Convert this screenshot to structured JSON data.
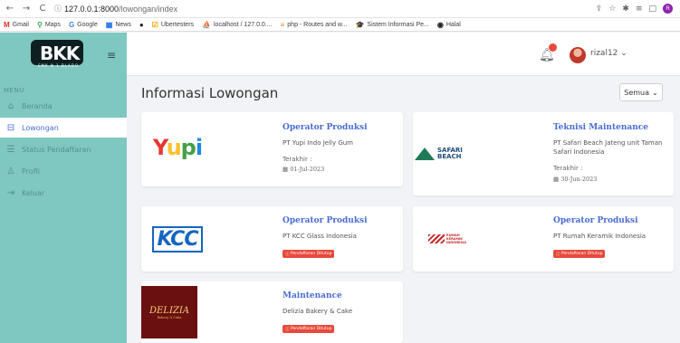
{
  "browser": {
    "url_host": "127.0.0.1:8000",
    "url_path": "/lowongan/index",
    "profile_initial": "R",
    "bookmarks": [
      "Gmail",
      "Maps",
      "Google",
      "News",
      "",
      "Ubertesters",
      "localhost / 127.0.0....",
      "php - Routes and w...",
      "Sistem Informasi Pe...",
      "Halal"
    ]
  },
  "brand": {
    "logo_text": "BKK",
    "logo_sub": "SMK N 1 BLADO"
  },
  "sidebar": {
    "menu_label": "MENU",
    "items": [
      {
        "label": "Beranda",
        "icon": "home-icon"
      },
      {
        "label": "Lowongan",
        "icon": "briefcase-icon"
      },
      {
        "label": "Status Pendaftaran",
        "icon": "list-icon"
      },
      {
        "label": "Profil",
        "icon": "user-icon"
      },
      {
        "label": "Keluar",
        "icon": "logout-icon"
      }
    ]
  },
  "header": {
    "notification_count": "",
    "username": "rizal12"
  },
  "main": {
    "title": "Informasi Lowongan",
    "filter_label": "Semua",
    "cards": [
      {
        "job": "Operator Produksi",
        "company": "PT Yupi Indo Jelly Gum",
        "deadline_label": "Terakhir :",
        "deadline": "01-Jul-2023",
        "logo": "Yupi"
      },
      {
        "job": "Teknisi Maintenance",
        "company": "PT Safari Beach Jateng unit Taman Safari Indonesia",
        "deadline_label": "Terakhir :",
        "deadline": "30-Jun-2023",
        "logo": "SAFARI BEACH"
      },
      {
        "job": "Operator Produksi",
        "company": "PT KCC Glass Indonesia",
        "status": "Pendaftaran Ditutup",
        "logo": "KCC"
      },
      {
        "job": "Operator Produksi",
        "company": "PT Rumah Keramik Indonesia",
        "status": "Pendaftaran Ditutup",
        "logo": "RUMAH KERAMIK INDONESIA"
      },
      {
        "job": "Maintenance",
        "company": "Delizia Bakery & Cake",
        "status": "Pendaftaran Ditutup",
        "logo": "DELIZIA",
        "logo_sub": "Bakery & Cake"
      }
    ]
  },
  "colors": {
    "sidebar": "#7fc7c1",
    "accent": "#4a6cd4",
    "danger": "#e74a3b"
  }
}
